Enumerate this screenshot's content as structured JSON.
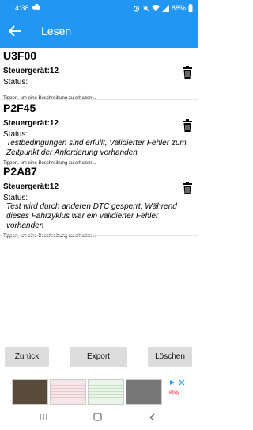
{
  "status_bar": {
    "time": "14:38",
    "battery": "88%"
  },
  "app_bar": {
    "title": "Lesen"
  },
  "items": [
    {
      "code": "U3F00",
      "unit": "Steuergerät:12",
      "status_label": "Status:",
      "description": "",
      "hint": "Tippen, um eine Beschreibung zu erhalten..."
    },
    {
      "code": "P2F45",
      "unit": "Steuergerät:12",
      "status_label": "Status:",
      "description": "Testbedingungen sind erfüllt, Validierter Fehler zum Zeitpunkt der Anforderung vorhanden",
      "hint": "Tippen, um eine Beschreibung zu erhalten..."
    },
    {
      "code": "P2A87",
      "unit": "Steuergerät:12",
      "status_label": "Status:",
      "description": "Test wird durch anderen DTC gesperrt, Während dieses Fahrzyklus war ein validierter Fehler vorhanden",
      "hint": "Tippen, um eine Beschreibung zu erhalten..."
    }
  ],
  "buttons": {
    "back": "Zurück",
    "export": "Export",
    "delete": "Löschen"
  },
  "ad": {
    "brand": "ebay"
  },
  "colors": {
    "primary": "#2196f3",
    "button_bg": "#dcdcdc"
  }
}
